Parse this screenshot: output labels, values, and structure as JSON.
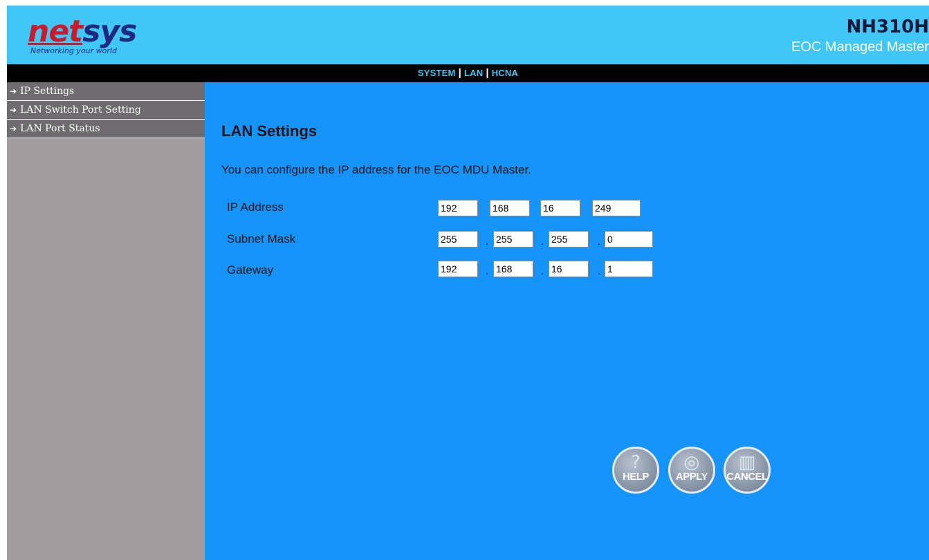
{
  "header": {
    "logo_part1": "net",
    "logo_part2": "sys",
    "logo_tagline": "Networking your world",
    "model": "NH310H",
    "product_desc": "EOC Managed Master"
  },
  "topnav": {
    "items": [
      "SYSTEM",
      "LAN",
      "HCNA"
    ],
    "separator": "|"
  },
  "sidebar": {
    "items": [
      {
        "label": "IP Settings"
      },
      {
        "label": "LAN Switch Port Setting"
      },
      {
        "label": "LAN Port Status"
      }
    ]
  },
  "main": {
    "title": "LAN Settings",
    "description": "You can configure the IP address for the EOC MDU Master.",
    "fields": {
      "ip": {
        "label": "IP Address",
        "octets": [
          "192",
          "168",
          "16",
          "249"
        ]
      },
      "subnet": {
        "label": "Subnet Mask",
        "octets": [
          "255",
          "255",
          "255",
          "0"
        ]
      },
      "gateway": {
        "label": "Gateway",
        "octets": [
          "192",
          "168",
          "16",
          "1"
        ]
      }
    },
    "dot": ".",
    "buttons": {
      "help": "HELP",
      "apply": "APPLY",
      "cancel": "CANCEL"
    }
  },
  "colors": {
    "header_bg": "#3fc8f7",
    "main_bg": "#1594fb",
    "sidebar_bg": "#a39b9e",
    "sidebar_item_bg": "#6e6c6e",
    "nav_bg": "#000000",
    "nav_link": "#3fc8f7"
  }
}
